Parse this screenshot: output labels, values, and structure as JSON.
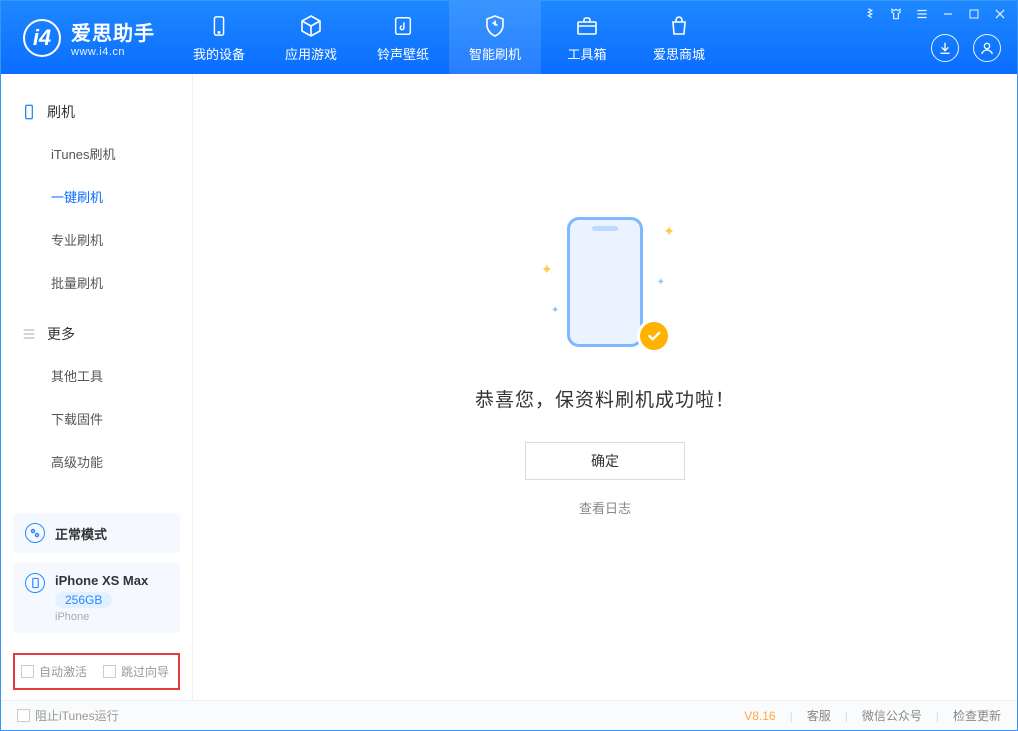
{
  "app": {
    "name": "爱思助手",
    "url": "www.i4.cn"
  },
  "nav": {
    "items": [
      {
        "label": "我的设备",
        "icon": "device"
      },
      {
        "label": "应用游戏",
        "icon": "cube"
      },
      {
        "label": "铃声壁纸",
        "icon": "music"
      },
      {
        "label": "智能刷机",
        "icon": "shield",
        "active": true
      },
      {
        "label": "工具箱",
        "icon": "toolbox"
      },
      {
        "label": "爱思商城",
        "icon": "store"
      }
    ]
  },
  "sidebar": {
    "sections": [
      {
        "title": "刷机",
        "icon": "phone",
        "items": [
          {
            "label": "iTunes刷机"
          },
          {
            "label": "一键刷机",
            "active": true
          },
          {
            "label": "专业刷机"
          },
          {
            "label": "批量刷机"
          }
        ]
      },
      {
        "title": "更多",
        "icon": "more",
        "items": [
          {
            "label": "其他工具"
          },
          {
            "label": "下载固件"
          },
          {
            "label": "高级功能"
          }
        ]
      }
    ],
    "mode_card": {
      "label": "正常模式"
    },
    "device_card": {
      "name": "iPhone XS Max",
      "storage": "256GB",
      "type": "iPhone"
    },
    "options": {
      "auto_activate": "自动激活",
      "skip_guide": "跳过向导"
    }
  },
  "main": {
    "success_msg": "恭喜您，保资料刷机成功啦！",
    "ok_btn": "确定",
    "view_log": "查看日志"
  },
  "footer": {
    "block_itunes": "阻止iTunes运行",
    "version": "V8.16",
    "links": {
      "service": "客服",
      "wechat": "微信公众号",
      "check_update": "检查更新"
    }
  }
}
